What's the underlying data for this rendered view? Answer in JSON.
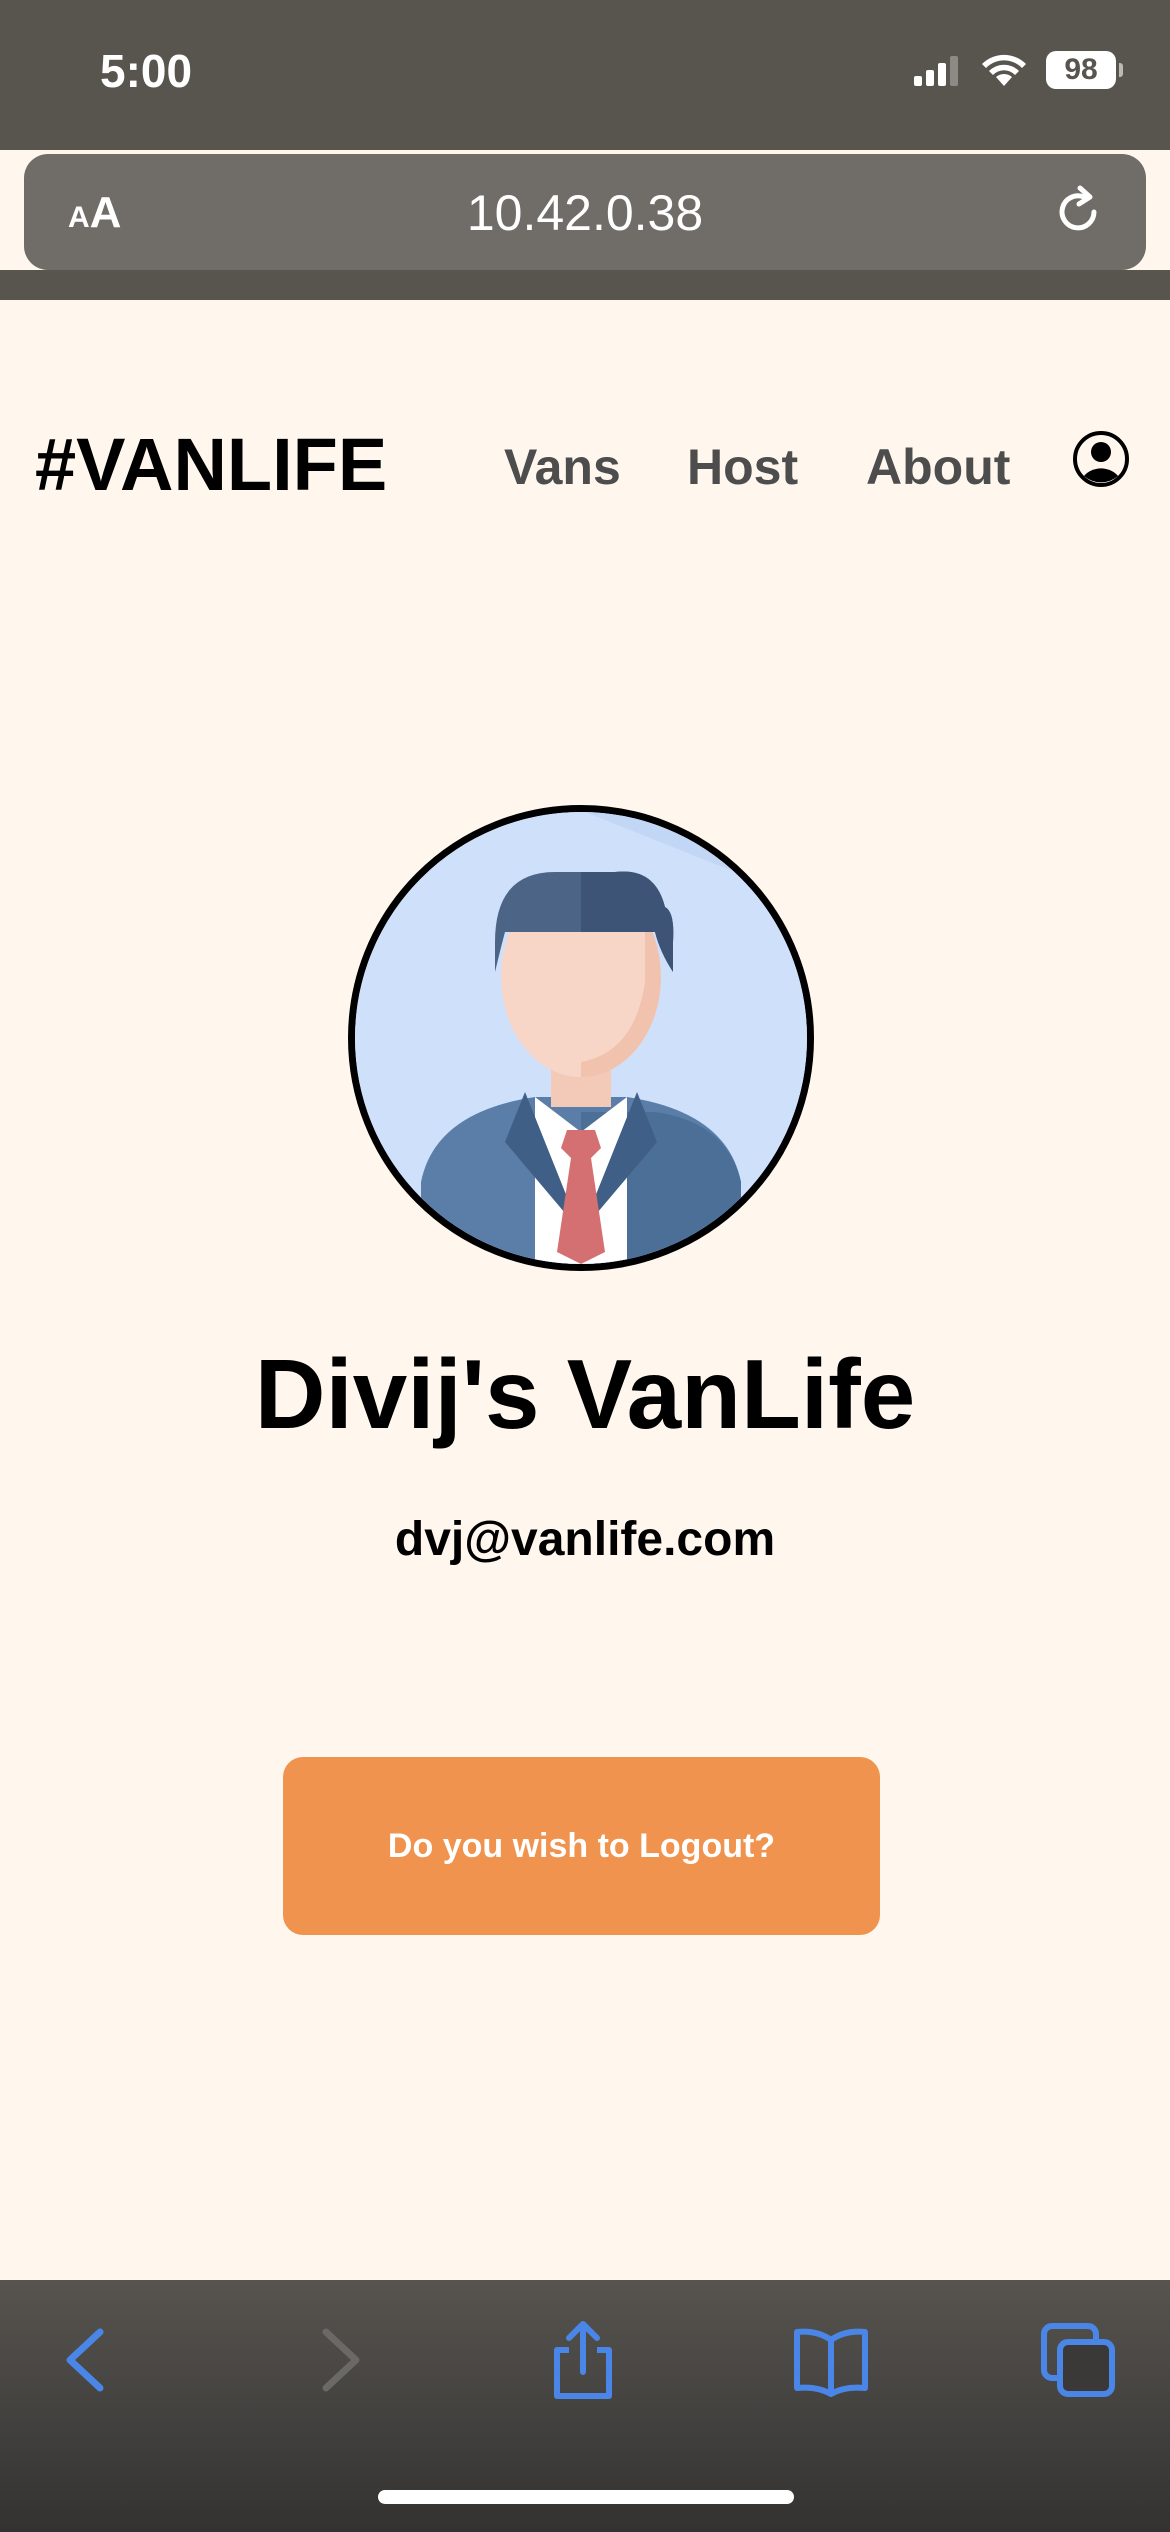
{
  "status_bar": {
    "time": "5:00",
    "battery": "98",
    "icons": [
      "signal-icon",
      "wifi-icon",
      "battery-icon"
    ]
  },
  "browser": {
    "aa_small": "A",
    "aa_big": "A",
    "url": "10.42.0.38",
    "reload_icon": "reload-icon",
    "toolbar_icons": [
      "back-icon",
      "forward-icon",
      "share-icon",
      "bookmarks-icon",
      "tabs-icon"
    ],
    "accent_color": "#4A86E8"
  },
  "header": {
    "logo": "#VANLIFE",
    "nav": [
      "Vans",
      "Host",
      "About"
    ],
    "account_icon": "account-circle-icon"
  },
  "profile": {
    "avatar_icon": "businessman-avatar-icon",
    "name": "Divij's VanLife",
    "email": "dvj@vanlife.com",
    "logout_label": "Do you wish to Logout?"
  },
  "colors": {
    "page_bg": "#FFF7ED",
    "button_bg": "#EF934E",
    "nav_text": "#4D4D4D",
    "chrome_bg": "#58554F"
  }
}
